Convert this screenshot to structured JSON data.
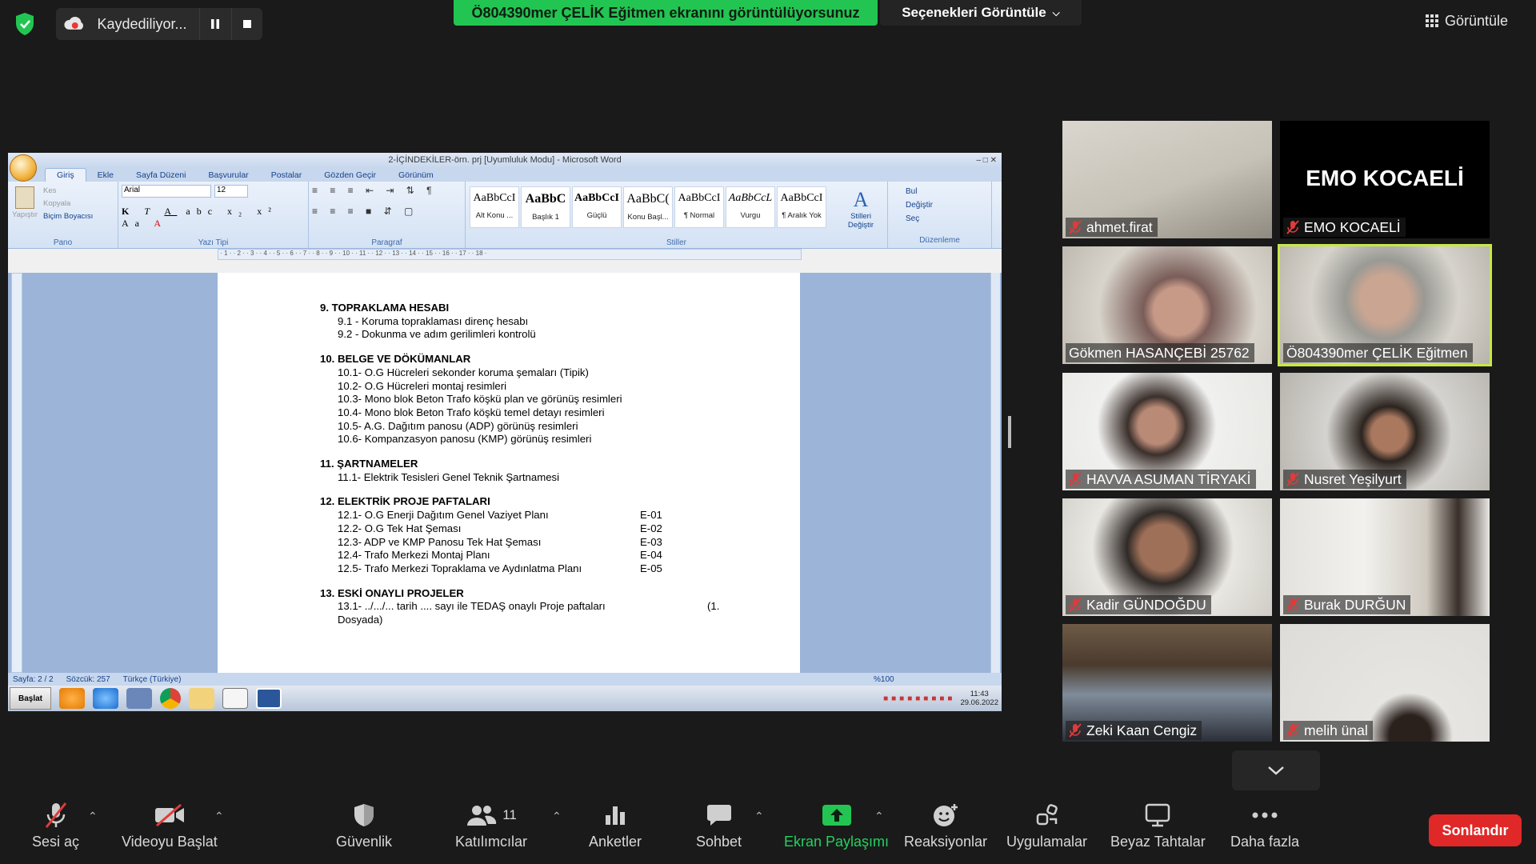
{
  "top": {
    "recording_label": "Kaydediliyor...",
    "share_banner": "Ö804390mer ÇELİK Eğitmen ekranını görüntülüyorsunuz",
    "view_options": "Seçenekleri Görüntüle",
    "view_button": "Görüntüle"
  },
  "word": {
    "title": "2-İÇİNDEKİLER-örn. prj [Uyumluluk Modu] - Microsoft Word",
    "tabs": [
      "Giriş",
      "Ekle",
      "Sayfa Düzeni",
      "Başvurular",
      "Postalar",
      "Gözden Geçir",
      "Görünüm"
    ],
    "font_name": "Arial",
    "font_size": "12",
    "clipboard": {
      "paste": "Yapıştır",
      "cut": "Kes",
      "copy": "Kopyala",
      "painter": "Biçim Boyacısı",
      "group": "Pano"
    },
    "group_font": "Yazı Tipi",
    "group_paragraph": "Paragraf",
    "group_styles": "Stiller",
    "group_editing": "Düzenleme",
    "styles": [
      {
        "sample": "AaBbCcI",
        "name": "Alt Konu ..."
      },
      {
        "sample": "AaBbC",
        "name": "Başlık 1"
      },
      {
        "sample": "AaBbCcI",
        "name": "Güçlü"
      },
      {
        "sample": "AaBbC(",
        "name": "Konu Başl..."
      },
      {
        "sample": "AaBbCcI",
        "name": "¶ Normal"
      },
      {
        "sample": "AaBbCcL",
        "name": "Vurgu"
      },
      {
        "sample": "AaBbCcI",
        "name": "¶ Aralık Yok"
      }
    ],
    "change_styles": "Stilleri Değiştir",
    "find": "Bul",
    "replace": "Değiştir",
    "select": "Seç",
    "status": {
      "page": "Sayfa: 2 / 2",
      "words": "Sözcük: 257",
      "lang": "Türkçe (Türkiye)",
      "zoom": "%100"
    },
    "start": "Başlat",
    "clock_time": "11:43",
    "clock_date": "29.06.2022",
    "doc": {
      "s9": {
        "title": "9.  TOPRAKLAMA HESABI",
        "items": [
          "9.1 - Koruma topraklaması direnç hesabı",
          "9.2 - Dokunma ve adım gerilimleri kontrolü"
        ]
      },
      "s10": {
        "title": "10. BELGE VE DÖKÜMANLAR",
        "items": [
          "10.1- O.G Hücreleri sekonder koruma şemaları (Tipik)",
          "10.2- O.G Hücreleri montaj resimleri",
          "10.3- Mono blok Beton Trafo köşkü plan ve görünüş resimleri",
          "10.4- Mono blok Beton Trafo köşkü temel detayı resimleri",
          "10.5- A.G. Dağıtım panosu (ADP) görünüş resimleri",
          "10.6- Kompanzasyon panosu (KMP) görünüş resimleri"
        ]
      },
      "s11": {
        "title": "11. ŞARTNAMELER",
        "items": [
          "11.1- Elektrik Tesisleri Genel Teknik Şartnamesi"
        ]
      },
      "s12": {
        "title": "12. ELEKTRİK PROJE PAFTALARI",
        "items": [
          {
            "text": "12.1- O.G Enerji Dağıtım Genel Vaziyet Planı",
            "code": "E-01"
          },
          {
            "text": "12.2- O.G Tek Hat Şeması",
            "code": "E-02"
          },
          {
            "text": "12.3- ADP  ve KMP Panosu Tek Hat Şeması",
            "code": "E-03"
          },
          {
            "text": "12.4- Trafo Merkezi Montaj Planı",
            "code": "E-04"
          },
          {
            "text": "12.5- Trafo Merkezi Topraklama ve Aydınlatma Planı",
            "code": "E-05"
          }
        ]
      },
      "s13": {
        "title": "13. ESKİ ONAYLI PROJELER",
        "line1": "13.1- ../.../... tarih  .... sayı ile TEDAŞ onaylı Proje paftaları",
        "line1_tail": "(1.",
        "line2": "Dosyada)"
      }
    }
  },
  "participants": [
    {
      "name": "ahmet.firat",
      "muted": true
    },
    {
      "name": "EMO KOCAELİ",
      "muted": true,
      "card_text": "EMO KOCAELİ"
    },
    {
      "name": "Gökmen HASANÇEBİ 25762",
      "muted": false
    },
    {
      "name": "Ö804390mer ÇELİK Eğitmen",
      "muted": false,
      "active": true
    },
    {
      "name": "HAVVA ASUMAN TİRYAKİ",
      "muted": true
    },
    {
      "name": "Nusret Yeşilyurt",
      "muted": true
    },
    {
      "name": "Kadir GÜNDOĞDU",
      "muted": true
    },
    {
      "name": "Burak DURĞUN",
      "muted": true
    },
    {
      "name": "Zeki Kaan Cengiz",
      "muted": true
    },
    {
      "name": "melih ünal",
      "muted": true
    }
  ],
  "toolbar": {
    "unmute": "Sesi aç",
    "start_video": "Videoyu Başlat",
    "security": "Güvenlik",
    "participants": "Katılımcılar",
    "participants_count": "11",
    "polls": "Anketler",
    "chat": "Sohbet",
    "share": "Ekran Paylaşımı",
    "reactions": "Reaksiyonlar",
    "apps": "Uygulamalar",
    "whiteboards": "Beyaz Tahtalar",
    "more": "Daha fazla",
    "end": "Sonlandır"
  },
  "colors": {
    "share_green": "#23c552",
    "active_border": "#c6e847",
    "end_red": "#e02828",
    "mute_red": "#e03a3a"
  }
}
